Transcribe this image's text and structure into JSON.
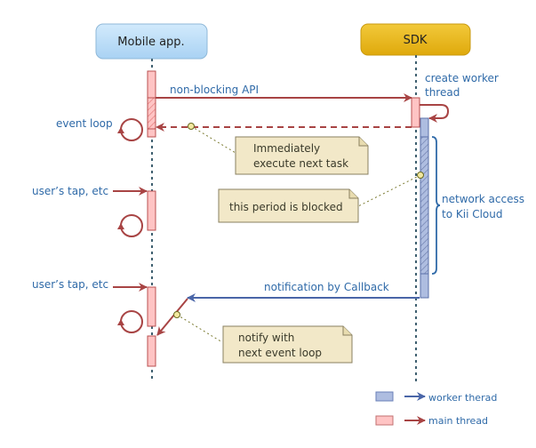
{
  "participants": {
    "mobile": "Mobile app.",
    "sdk": "SDK"
  },
  "messages": {
    "non_blocking": "non-blocking API",
    "create_worker_1": "create worker",
    "create_worker_2": "thread",
    "event_loop": "event loop",
    "user_tap_1": "user’s tap, etc",
    "user_tap_2": "user’s tap, etc",
    "network_1": "network access",
    "network_2": "to Kii Cloud",
    "callback": "notification by Callback"
  },
  "notes": {
    "immediate_1": "Immediately",
    "immediate_2": "execute next task",
    "blocked": "this period is blocked",
    "notify_1": "notify with",
    "notify_2": "next event loop"
  },
  "legend": [
    {
      "label": "worker therad",
      "color": "#4a66a8"
    },
    {
      "label": "main thread",
      "color": "#a84444"
    }
  ],
  "colors": {
    "main": "#a84444",
    "worker": "#4a66a8",
    "main_fill": "#ffc4c4",
    "worker_fill": "#aebde0",
    "note_fill": "#f2e8c8",
    "mobile_fill": "#b9dcf7",
    "sdk_fill": "#e6b315",
    "label": "#2f6aa8"
  }
}
